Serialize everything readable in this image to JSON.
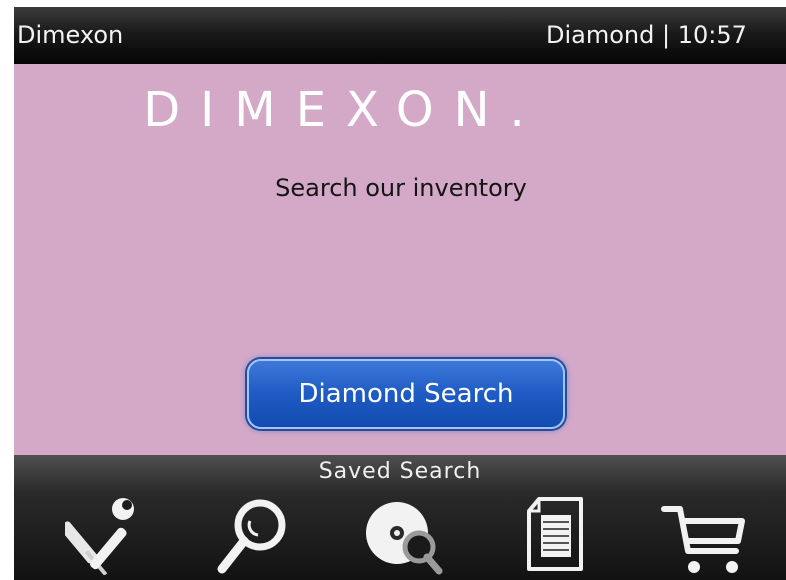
{
  "statusbar": {
    "app_title": "Dimexon",
    "right_status": "Diamond | 10:57"
  },
  "main": {
    "logo_text": "DIMEXON.",
    "tagline": "Search our inventory",
    "primary_button_label": "Diamond Search"
  },
  "toolbar": {
    "focused_label": "Saved Search",
    "items": [
      {
        "icon": "tools-icon"
      },
      {
        "icon": "search-icon"
      },
      {
        "icon": "diamond-search-icon"
      },
      {
        "icon": "document-icon"
      },
      {
        "icon": "cart-icon"
      }
    ]
  },
  "colors": {
    "content_bg": "#d4a9c8",
    "button_bg": "#1e5bc4",
    "statusbar_bg": "#1a1a1a"
  }
}
